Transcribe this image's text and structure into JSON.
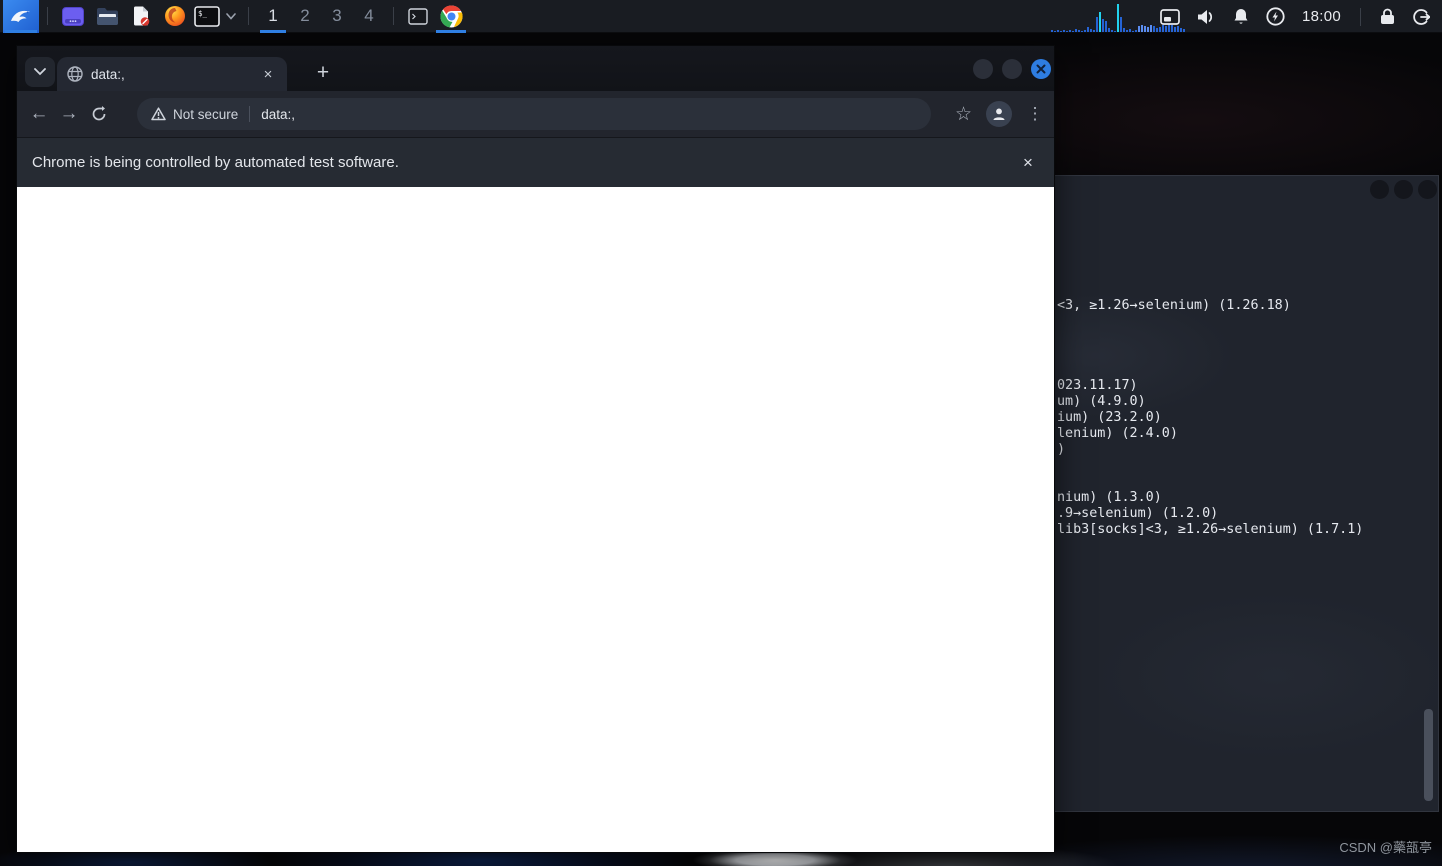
{
  "taskbar": {
    "workspaces": [
      {
        "label": "1",
        "active": true
      },
      {
        "label": "2",
        "active": false
      },
      {
        "label": "3",
        "active": false
      },
      {
        "label": "4",
        "active": false
      }
    ],
    "clock": "18:00",
    "terminal_launcher_prompt": "$_",
    "net_graph": {
      "bar_colors": {
        "b": "#2563d4",
        "c": "#22d3ee",
        "l": "#5b8df0"
      },
      "bars": [
        [
          2,
          "b"
        ],
        [
          1,
          "b"
        ],
        [
          2,
          "b"
        ],
        [
          1,
          "b"
        ],
        [
          2,
          "b"
        ],
        [
          1,
          "b"
        ],
        [
          2,
          "b"
        ],
        [
          1,
          "b"
        ],
        [
          3,
          "b"
        ],
        [
          2,
          "b"
        ],
        [
          1,
          "b"
        ],
        [
          2,
          "b"
        ],
        [
          5,
          "b"
        ],
        [
          3,
          "b"
        ],
        [
          2,
          "b"
        ],
        [
          15,
          "b"
        ],
        [
          20,
          "c"
        ],
        [
          13,
          "b"
        ],
        [
          11,
          "b"
        ],
        [
          4,
          "b"
        ],
        [
          2,
          "b"
        ],
        [
          1,
          "b"
        ],
        [
          28,
          "c"
        ],
        [
          15,
          "b"
        ],
        [
          4,
          "b"
        ],
        [
          2,
          "b"
        ],
        [
          3,
          "b"
        ],
        [
          1,
          "b"
        ],
        [
          2,
          "b"
        ],
        [
          6,
          "l"
        ],
        [
          7,
          "l"
        ],
        [
          6,
          "l"
        ],
        [
          5,
          "l"
        ],
        [
          7,
          "l"
        ],
        [
          6,
          "b"
        ],
        [
          4,
          "b"
        ],
        [
          5,
          "b"
        ],
        [
          7,
          "b"
        ],
        [
          6,
          "b"
        ],
        [
          8,
          "b"
        ],
        [
          7,
          "b"
        ],
        [
          5,
          "b"
        ],
        [
          6,
          "b"
        ],
        [
          4,
          "b"
        ],
        [
          3,
          "b"
        ]
      ]
    }
  },
  "browser": {
    "tab": {
      "title": "data:,"
    },
    "glyphs": {
      "close": "×",
      "plus": "+",
      "back": "←",
      "forward": "→",
      "star": "☆",
      "kebab": "⋮"
    },
    "toolbar": {
      "security_label": "Not secure",
      "url": "data:,"
    },
    "infobar": {
      "message": "Chrome is being controlled by automated test software."
    }
  },
  "terminal": {
    "blocks": [
      {
        "lines": [
          "<3, ≥1.26→selenium) (1.26.18)"
        ]
      },
      {
        "lines": [
          "023.11.17)",
          "um) (4.9.0)",
          "ium) (23.2.0)",
          "lenium) (2.4.0)",
          ")"
        ]
      },
      {
        "lines": [
          "nium) (1.3.0)",
          ".9→selenium) (1.2.0)",
          "lib3[socks]<3, ≥1.26→selenium) (1.7.1)"
        ]
      }
    ]
  },
  "watermark": "CSDN @藥瓿亭",
  "colors": {
    "accent_blue": "#2f7fe3",
    "close_button_blue": "#2e7de1",
    "taskbar_bg": "#191c22",
    "toolbar_bg": "#22252d",
    "infobar_bg": "#262b33",
    "terminal_bg": "#20242d",
    "page_bg": "#ffffff"
  }
}
